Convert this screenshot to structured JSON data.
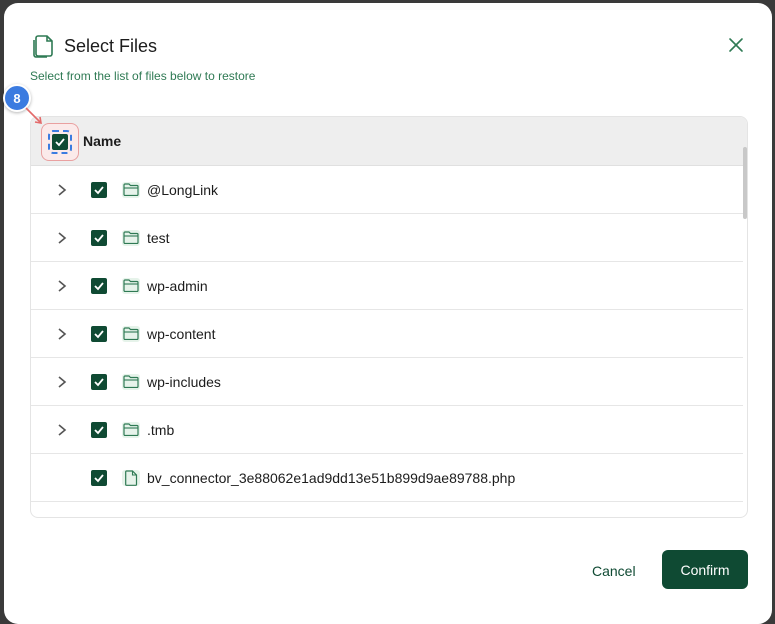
{
  "dialog": {
    "title": "Select Files",
    "subtitle": "Select from the list of files below to restore",
    "close_icon": "close-icon",
    "header_icon": "files-icon"
  },
  "table": {
    "header_label": "Name",
    "header_checked": true,
    "rows": [
      {
        "label": "@LongLink",
        "type": "folder",
        "checked": true,
        "expandable": true
      },
      {
        "label": "test",
        "type": "folder",
        "checked": true,
        "expandable": true
      },
      {
        "label": "wp-admin",
        "type": "folder",
        "checked": true,
        "expandable": true
      },
      {
        "label": "wp-content",
        "type": "folder",
        "checked": true,
        "expandable": true
      },
      {
        "label": "wp-includes",
        "type": "folder",
        "checked": true,
        "expandable": true
      },
      {
        "label": ".tmb",
        "type": "folder",
        "checked": true,
        "expandable": true
      },
      {
        "label": "bv_connector_3e88062e1ad9dd13e51b899d9ae89788.php",
        "type": "file",
        "checked": true,
        "expandable": false
      }
    ]
  },
  "footer": {
    "cancel_label": "Cancel",
    "confirm_label": "Confirm"
  },
  "annotation": {
    "step_number": "8"
  },
  "colors": {
    "accent": "#0f4a33",
    "subtitle": "#2f7a54",
    "badge": "#3b7be0"
  }
}
